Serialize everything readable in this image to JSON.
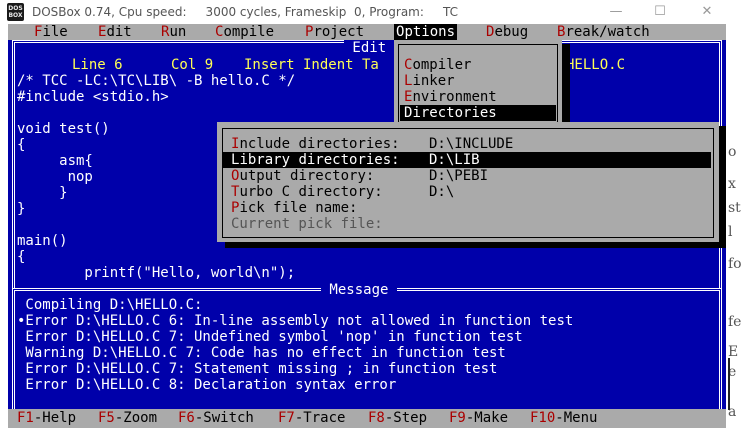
{
  "window": {
    "title": "DOSBox 0.74, Cpu speed:     3000 cycles, Frameskip  0, Program:     TC",
    "icon_text": [
      "DOS",
      "BOX"
    ],
    "minimize_glyph": "—",
    "maximize_glyph": "☐",
    "close_glyph": "✕",
    "background_page_letters": [
      "o",
      "x",
      "st",
      "l",
      "fo",
      "fe",
      "E",
      "e",
      "a"
    ]
  },
  "colors": {
    "dos_blue": "#0000aa",
    "menu_gray": "#aaaaaa",
    "hotkey_red": "#aa0000",
    "status_yellow": "#ffff55"
  },
  "menubar": {
    "items": [
      {
        "hot": "F",
        "rest": "ile"
      },
      {
        "hot": "E",
        "rest": "dit"
      },
      {
        "hot": "R",
        "rest": "un"
      },
      {
        "hot": "C",
        "rest": "ompile"
      },
      {
        "hot": "P",
        "rest": "roject"
      },
      {
        "hot": "O",
        "rest": "ptions"
      },
      {
        "hot": "D",
        "rest": "ebug"
      },
      {
        "hot": "B",
        "rest": "reak/watch"
      }
    ]
  },
  "editor": {
    "title": " Edit ",
    "line": "Line 6",
    "col": "Col 9",
    "mode": "Insert Indent Ta",
    "filename": "HELLO.C",
    "code": [
      "/* TCC -LC:\\TC\\LIB\\ -B hello.C */",
      "#include <stdio.h>",
      "",
      "void test()",
      "{",
      "     asm{",
      "      nop",
      "     }",
      "}",
      "",
      "main()",
      "{",
      "        printf(\"Hello, world\\n\");"
    ]
  },
  "options_menu": {
    "items": [
      {
        "hot": "C",
        "rest": "ompiler"
      },
      {
        "hot": "L",
        "rest": "inker"
      },
      {
        "hot": "E",
        "rest": "nvironment"
      },
      {
        "hot": "D",
        "rest": "irectories"
      }
    ]
  },
  "directories_dialog": {
    "items": [
      {
        "hot": "I",
        "rest": "nclude directories:",
        "value": "D:\\INCLUDE"
      },
      {
        "hot": "L",
        "rest": "ibrary directories:",
        "value": "D:\\LIB"
      },
      {
        "hot": "O",
        "rest": "utput directory:",
        "value": "D:\\PEBI"
      },
      {
        "hot": "T",
        "rest": "urbo C directory:",
        "value": "D:\\"
      },
      {
        "hot": "P",
        "rest": "ick file name:",
        "value": ""
      },
      {
        "hot": "",
        "rest": "Current pick file:",
        "value": ""
      }
    ]
  },
  "message_window": {
    "title": " Message ",
    "lines": [
      " Compiling D:\\HELLO.C:",
      "•Error D:\\HELLO.C 6: In-line assembly not allowed in function test",
      " Error D:\\HELLO.C 7: Undefined symbol 'nop' in function test",
      " Warning D:\\HELLO.C 7: Code has no effect in function test",
      " Error D:\\HELLO.C 7: Statement missing ; in function test",
      " Error D:\\HELLO.C 8: Declaration syntax error"
    ]
  },
  "function_bar": {
    "keys": [
      {
        "key": "F1",
        "label": "-Help"
      },
      {
        "key": "F5",
        "label": "-Zoom"
      },
      {
        "key": "F6",
        "label": "-Switch"
      },
      {
        "key": "F7",
        "label": "-Trace"
      },
      {
        "key": "F8",
        "label": "-Step"
      },
      {
        "key": "F9",
        "label": "-Make"
      },
      {
        "key": "F10",
        "label": "-Menu"
      }
    ]
  }
}
